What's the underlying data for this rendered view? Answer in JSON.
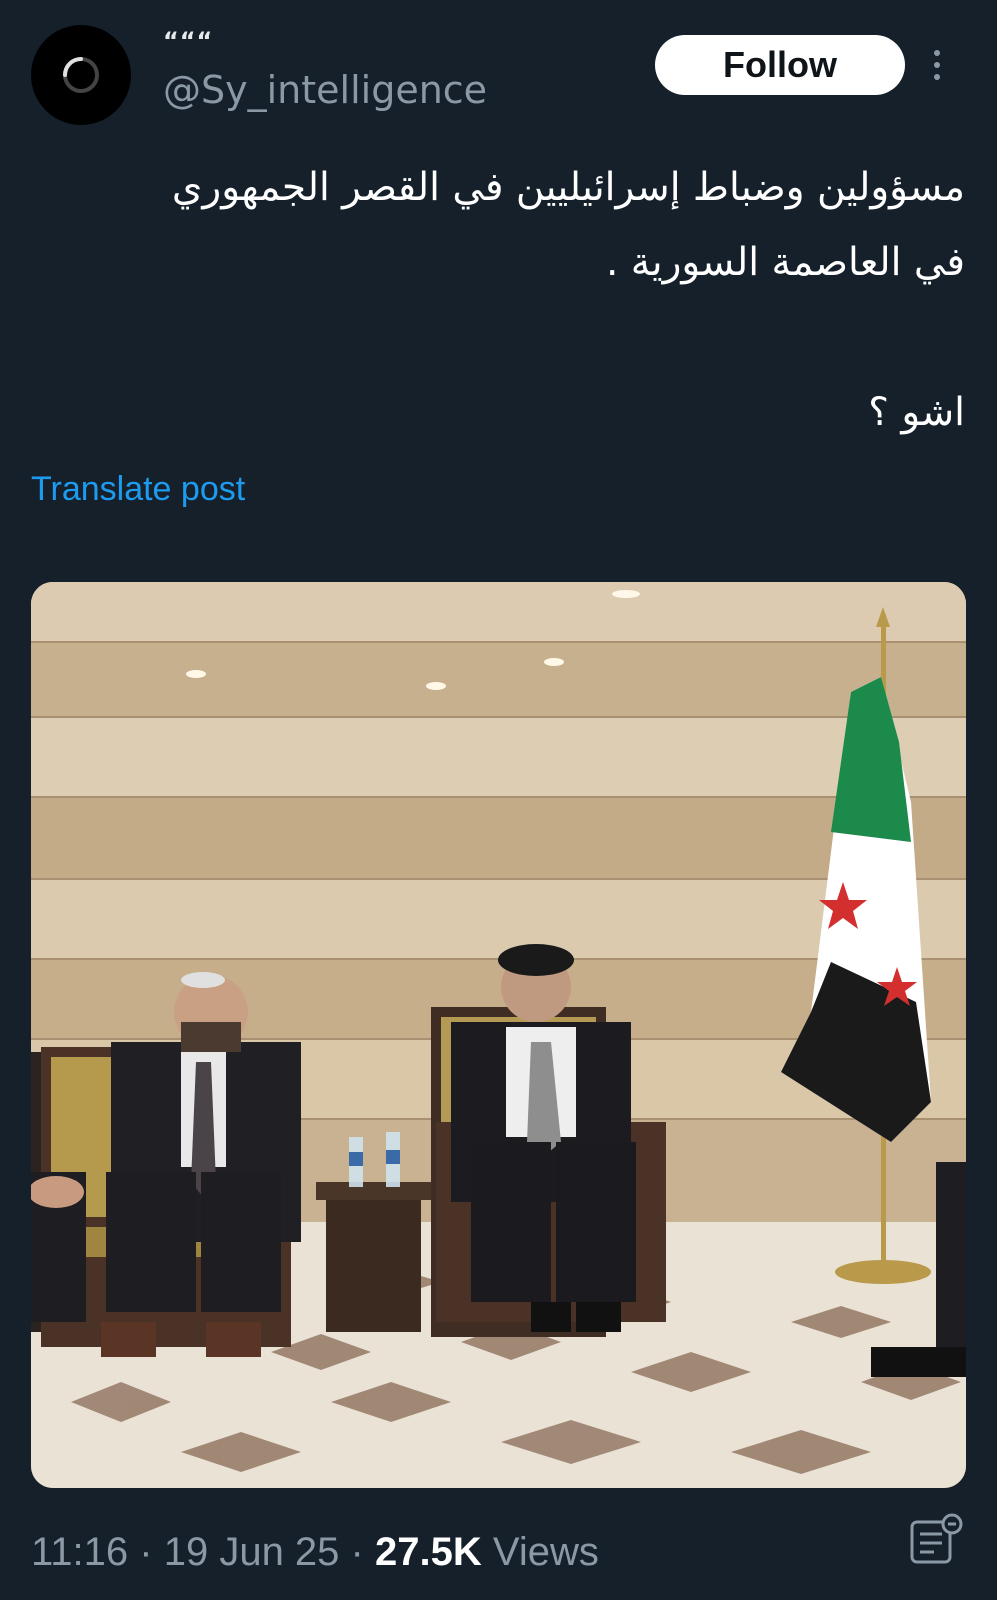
{
  "author": {
    "display_name": "“““",
    "handle": "@Sy_intelligence",
    "avatar_icon": "loading-ring-icon"
  },
  "actions": {
    "follow_label": "Follow",
    "more_icon": "more-vertical-icon"
  },
  "post": {
    "lines": [
      "مسؤولين وضباط إسرائيليين في القصر الجمهوري",
      "في العاصمة السورية .",
      "اشو ؟"
    ],
    "translate_label": "Translate post",
    "media_alt_icon": "photo"
  },
  "meta": {
    "time": "11:16",
    "date": "19 Jun 25",
    "separator": "·",
    "views_count": "27.5K",
    "views_label": "Views",
    "analytics_icon": "analytics-icon"
  },
  "colors": {
    "background": "#15202b",
    "accent": "#1d9bf0",
    "muted": "#8b98a5"
  }
}
